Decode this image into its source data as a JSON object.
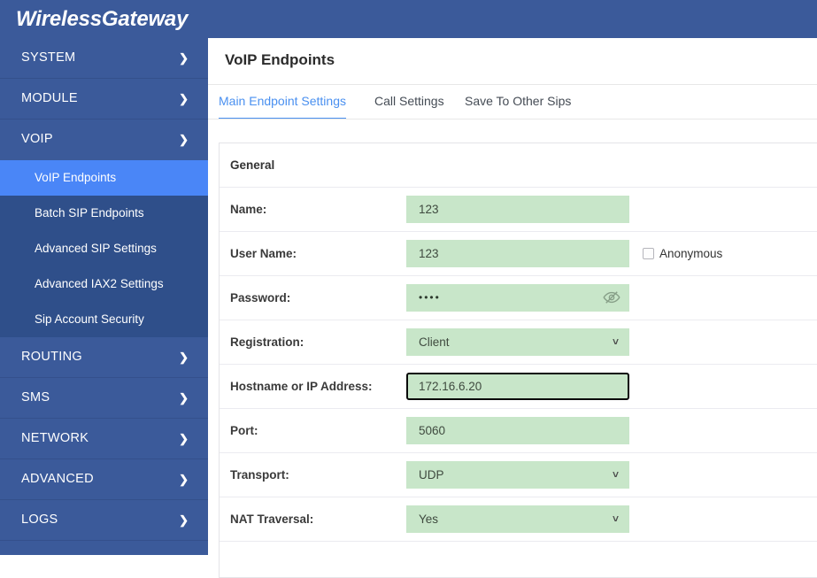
{
  "brand": {
    "title": "WirelessGateway"
  },
  "sidebar": {
    "items": [
      {
        "label": "SYSTEM",
        "icon": "chevron-right-icon",
        "expanded": false
      },
      {
        "label": "MODULE",
        "icon": "chevron-right-icon",
        "expanded": false
      },
      {
        "label": "VOIP",
        "icon": "chevron-down-icon",
        "expanded": true
      },
      {
        "label": "ROUTING",
        "icon": "chevron-right-icon",
        "expanded": false
      },
      {
        "label": "SMS",
        "icon": "chevron-right-icon",
        "expanded": false
      },
      {
        "label": "NETWORK",
        "icon": "chevron-right-icon",
        "expanded": false
      },
      {
        "label": "ADVANCED",
        "icon": "chevron-right-icon",
        "expanded": false
      },
      {
        "label": "LOGS",
        "icon": "chevron-right-icon",
        "expanded": false
      }
    ],
    "voip_submenu": [
      {
        "label": "VoIP Endpoints",
        "active": true
      },
      {
        "label": "Batch SIP Endpoints",
        "active": false
      },
      {
        "label": "Advanced SIP Settings",
        "active": false
      },
      {
        "label": "Advanced IAX2 Settings",
        "active": false
      },
      {
        "label": "Sip Account Security",
        "active": false
      }
    ]
  },
  "main": {
    "page_title": "VoIP Endpoints",
    "tabs": [
      {
        "label": "Main Endpoint Settings",
        "active": true
      },
      {
        "label": "Call Settings",
        "active": false
      },
      {
        "label": "Save To Other Sips",
        "active": false
      }
    ],
    "section_title": "General",
    "fields": {
      "name": {
        "label": "Name:",
        "value": "123"
      },
      "user_name": {
        "label": "User Name:",
        "value": "123"
      },
      "anonymous": {
        "label": "Anonymous",
        "checked": false
      },
      "password": {
        "label": "Password:",
        "value": "••••",
        "icon": "eye-slash-icon"
      },
      "registration": {
        "label": "Registration:",
        "value": "Client"
      },
      "hostname": {
        "label": "Hostname or IP Address:",
        "value": "172.16.6.20",
        "focused": true
      },
      "port": {
        "label": "Port:",
        "value": "5060"
      },
      "transport": {
        "label": "Transport:",
        "value": "UDP"
      },
      "nat_traversal": {
        "label": "NAT Traversal:",
        "value": "Yes"
      }
    }
  },
  "colors": {
    "header_blue": "#3b5a9a",
    "submenu_blue": "#2f4f8a",
    "active_blue": "#4a86f7",
    "tab_active": "#4a90f0",
    "field_green": "#c8e6c9"
  }
}
